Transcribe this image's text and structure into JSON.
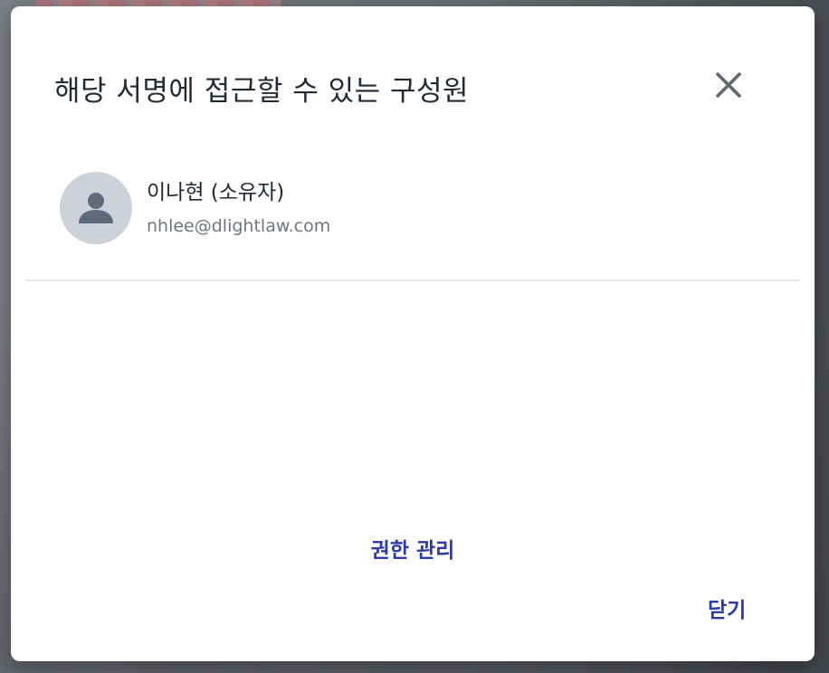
{
  "dialog": {
    "title": "해당 서명에 접근할 수 있는 구성원",
    "close_icon": "close-icon"
  },
  "members": [
    {
      "name": "이나현 (소유자)",
      "email": "nhlee@dlightlaw.com",
      "avatar_icon": "person-icon"
    }
  ],
  "actions": {
    "manage_label": "권한 관리",
    "close_label": "닫기"
  },
  "colors": {
    "accent": "#2b3aa8",
    "title_text": "#222a33",
    "secondary_text": "#6f7680",
    "avatar_bg": "#cdd2d9",
    "avatar_icon": "#5f6b7a",
    "divider": "#e3e5e8"
  }
}
